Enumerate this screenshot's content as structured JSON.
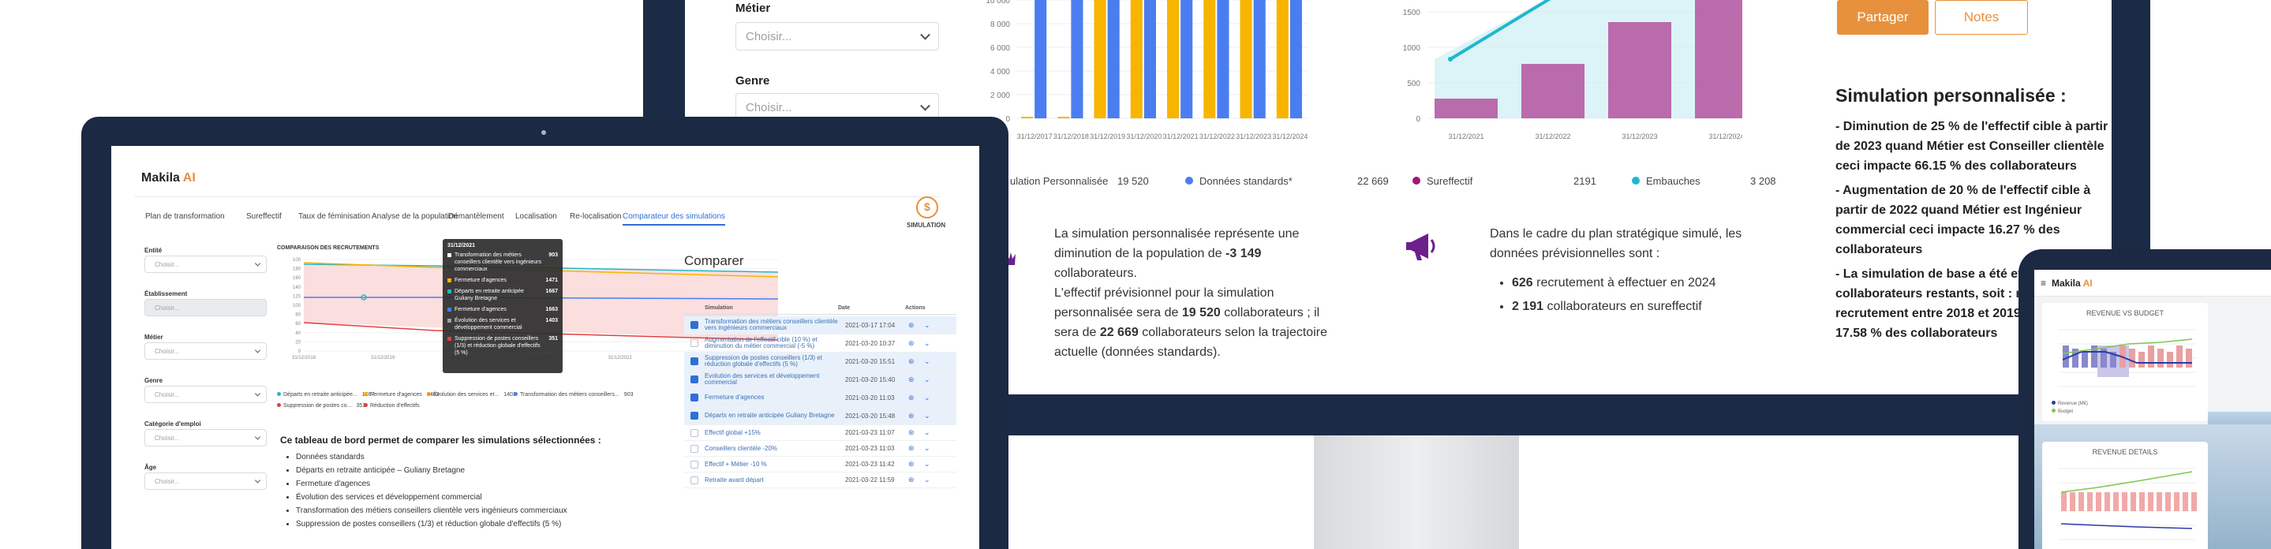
{
  "monitor": {
    "form": {
      "metier_label": "Métier",
      "metier_placeholder": "Choisir...",
      "genre_label": "Genre",
      "genre_placeholder": "Choisir..."
    },
    "chart_left": {
      "yticks": [
        "10 000",
        "8 000",
        "6 000",
        "4 000",
        "2 000",
        "0"
      ],
      "xticks": [
        "31/12/2017",
        "31/12/2018",
        "31/12/2019",
        "31/12/2020",
        "31/12/2021",
        "31/12/2022",
        "31/12/2023",
        "31/12/2024"
      ],
      "legend": [
        {
          "label": "ulation Personnalisée",
          "value": "19 520",
          "color": "#f7b500"
        },
        {
          "label": "Données standards*",
          "value": "22 669",
          "color": "#4a7ef0"
        }
      ]
    },
    "chart_right": {
      "yticks": [
        "1500",
        "1000",
        "500",
        "0"
      ],
      "xticks": [
        "31/12/2021",
        "31/12/2022",
        "31/12/2023",
        "31/12/2024"
      ],
      "legend": [
        {
          "label": "Sureffectif",
          "value": "2191",
          "color": "#a2177a"
        },
        {
          "label": "Embauches",
          "value": "3 208",
          "color": "#20b7cc"
        }
      ]
    },
    "summary_left": {
      "line1": "La simulation personnalisée représente une",
      "line2a": "diminution de la population de ",
      "line2b": "-3 149",
      "line3": "collaborateurs.",
      "line4": "L'effectif prévisionnel pour la simulation",
      "line5a": "personnalisée sera de ",
      "line5b": "19 520",
      "line5c": " collaborateurs ; il",
      "line6a": "sera de ",
      "line6b": "22 669",
      "line6c": " collaborateurs selon la trajectoire",
      "line7": "actuelle (données standards)."
    },
    "summary_right": {
      "line1": "Dans le cadre du plan stratégique simulé, les",
      "line2": "données prévisionnelles sont :",
      "b1a": "626",
      "b1b": " recrutement à effectuer en 2024",
      "b2a": "2 191",
      "b2b": " collaborateurs en sureffectif"
    },
    "share_button": "Partager",
    "notes_button": "Notes",
    "simu_title": "Simulation personnalisée :",
    "simu_items": [
      [
        "- Diminution de 25 % de l'effectif cible à partir",
        "de 2023 quand Métier est Conseiller clientèle",
        "ceci impacte 66.15 % des collaborateurs"
      ],
      [
        "- Augmentation de 20 % de l'effectif cible à",
        "partir de 2022 quand Métier est Ingénieur",
        "commercial ceci impacte 16.27 % des",
        "collaborateurs"
      ],
      [
        "- La simulation de base a été ef",
        "collaborateurs restants, soit : n",
        "recrutement entre 2018 et 2019",
        "17.58 % des collaborateurs"
      ]
    ]
  },
  "laptop": {
    "logo_prefix": "Makila",
    "logo_suffix": "AI",
    "tabs": [
      "Plan de transformation",
      "Sureffectif",
      "Taux de féminisation",
      "Analyse de la population",
      "Démantèlement",
      "Localisation",
      "Re-localisation",
      "Comparateur des simulations"
    ],
    "simulation_label": "SIMULATION",
    "filters": [
      {
        "label": "Entité",
        "placeholder": "Choisir..."
      },
      {
        "label": "Établissement",
        "placeholder": "Choisir..."
      },
      {
        "label": "Métier",
        "placeholder": "Choisir..."
      },
      {
        "label": "Genre",
        "placeholder": "Choisir..."
      },
      {
        "label": "Catégorie d'emploi",
        "placeholder": "Choisir..."
      },
      {
        "label": "Âge",
        "placeholder": "Choisir..."
      }
    ],
    "chart_title": "COMPARAISON DES RECRUTEMENTS",
    "chart_yticks": [
      "100",
      "180",
      "160",
      "140",
      "120",
      "100",
      "80",
      "60",
      "40",
      "20",
      "0"
    ],
    "chart_xticks": [
      "31/12/2018",
      "31/12/2019",
      "31/12/2020",
      "31/12/2021",
      "31/12/2022",
      "31/12/2023",
      "31/12/2024"
    ],
    "tooltip": {
      "date": "31/12/2021",
      "rows": [
        {
          "label": "Transformation des métiers conseillers clientèle vers ingénieurs commerciaux",
          "value": "903",
          "color": "#ffffff"
        },
        {
          "label": "Fermeture d'agences",
          "value": "1471",
          "color": "#f7b500"
        },
        {
          "label": "Départs en retraite anticipée Guliany Bretagne",
          "value": "1667",
          "color": "#22b8c8"
        },
        {
          "label": "Fermeture d'agences",
          "value": "1663",
          "color": "#4a7ef0"
        },
        {
          "label": "Évolution des services et développement commercial",
          "value": "1403",
          "color": "#a0a0a0"
        },
        {
          "label": "Suppression de postes conseillers (1/3) et réduction globale d'effectifs (5 %)",
          "value": "351",
          "color": "#e04040"
        }
      ]
    },
    "chart_legend": [
      {
        "label": "Départs en retraite anticipée...",
        "value": "1667",
        "color": "#22b8c8"
      },
      {
        "label": "Fermeture d'agences",
        "value": "1462",
        "color": "#f7b500"
      },
      {
        "label": "Évolution des services et...",
        "value": "1403",
        "color": "#e8a020"
      },
      {
        "label": "Transformation des métiers conseillers...",
        "value": "903",
        "color": "#4a7ef0"
      },
      {
        "label": "Suppression de postes co...",
        "value": "351",
        "color": "#e04040"
      },
      {
        "label": "Réduction d'effectifs",
        "value": "",
        "color": "#e04040"
      }
    ],
    "desc_title": "Ce tableau de bord permet de comparer les simulations sélectionnées :",
    "desc_items": [
      "Données standards",
      "Départs en retraite anticipée – Guliany Bretagne",
      "Fermeture d'agences",
      "Évolution des services et développement commercial",
      "Transformation des métiers conseillers clientèle vers ingénieurs commerciaux",
      "Suppression de postes conseillers (1/3) et réduction globale d'effectifs (5 %)"
    ],
    "compare_title": "Comparer",
    "table_headers": [
      "Simulation",
      "Date",
      "Actions"
    ],
    "table_rows": [
      {
        "name": "Transformation des métiers conseillers clientèle vers ingénieurs commerciaux",
        "date": "2021-03-17 17:04",
        "checked": true
      },
      {
        "name": "Augmentation de l'effectif cible (10 %) et diminution du métier commercial (-5 %)",
        "date": "2021-03-20 10:37",
        "checked": false
      },
      {
        "name": "Suppression de postes conseillers (1/3) et réduction globale d'effectifs (5 %)",
        "date": "2021-03-20 15:51",
        "checked": true
      },
      {
        "name": "Évolution des services et développement commercial",
        "date": "2021-03-20 15:40",
        "checked": true
      },
      {
        "name": "Fermeture d'agences",
        "date": "2021-03-20 11:03",
        "checked": true
      },
      {
        "name": "Départs en retraite anticipée Guliany Bretagne",
        "date": "2021-03-20 15:48",
        "checked": true
      },
      {
        "name": "Effectif global +15%",
        "date": "2021-03-23 11:07",
        "checked": false
      },
      {
        "name": "Conseillers clientèle -20%",
        "date": "2021-03-23 11:03",
        "checked": false
      },
      {
        "name": "Effectif + Métier -10 %",
        "date": "2021-03-23 11:42",
        "checked": false
      },
      {
        "name": "Retraite avant départ",
        "date": "2021-03-22 11:59",
        "checked": false
      }
    ]
  },
  "phone": {
    "logo_prefix": "Makila",
    "logo_suffix": "AI",
    "card1_title": "REVENUE VS BUDGET",
    "card1_legend": [
      "Revenue (M€)",
      "Budget"
    ],
    "card2_title": "REVENUE DETAILS"
  },
  "colors": {
    "navy": "#1c2b45",
    "orange": "#e8913c",
    "purple": "#a2177a",
    "teal": "#20b7cc",
    "yellow": "#f7b500",
    "blue": "#4a7ef0"
  }
}
